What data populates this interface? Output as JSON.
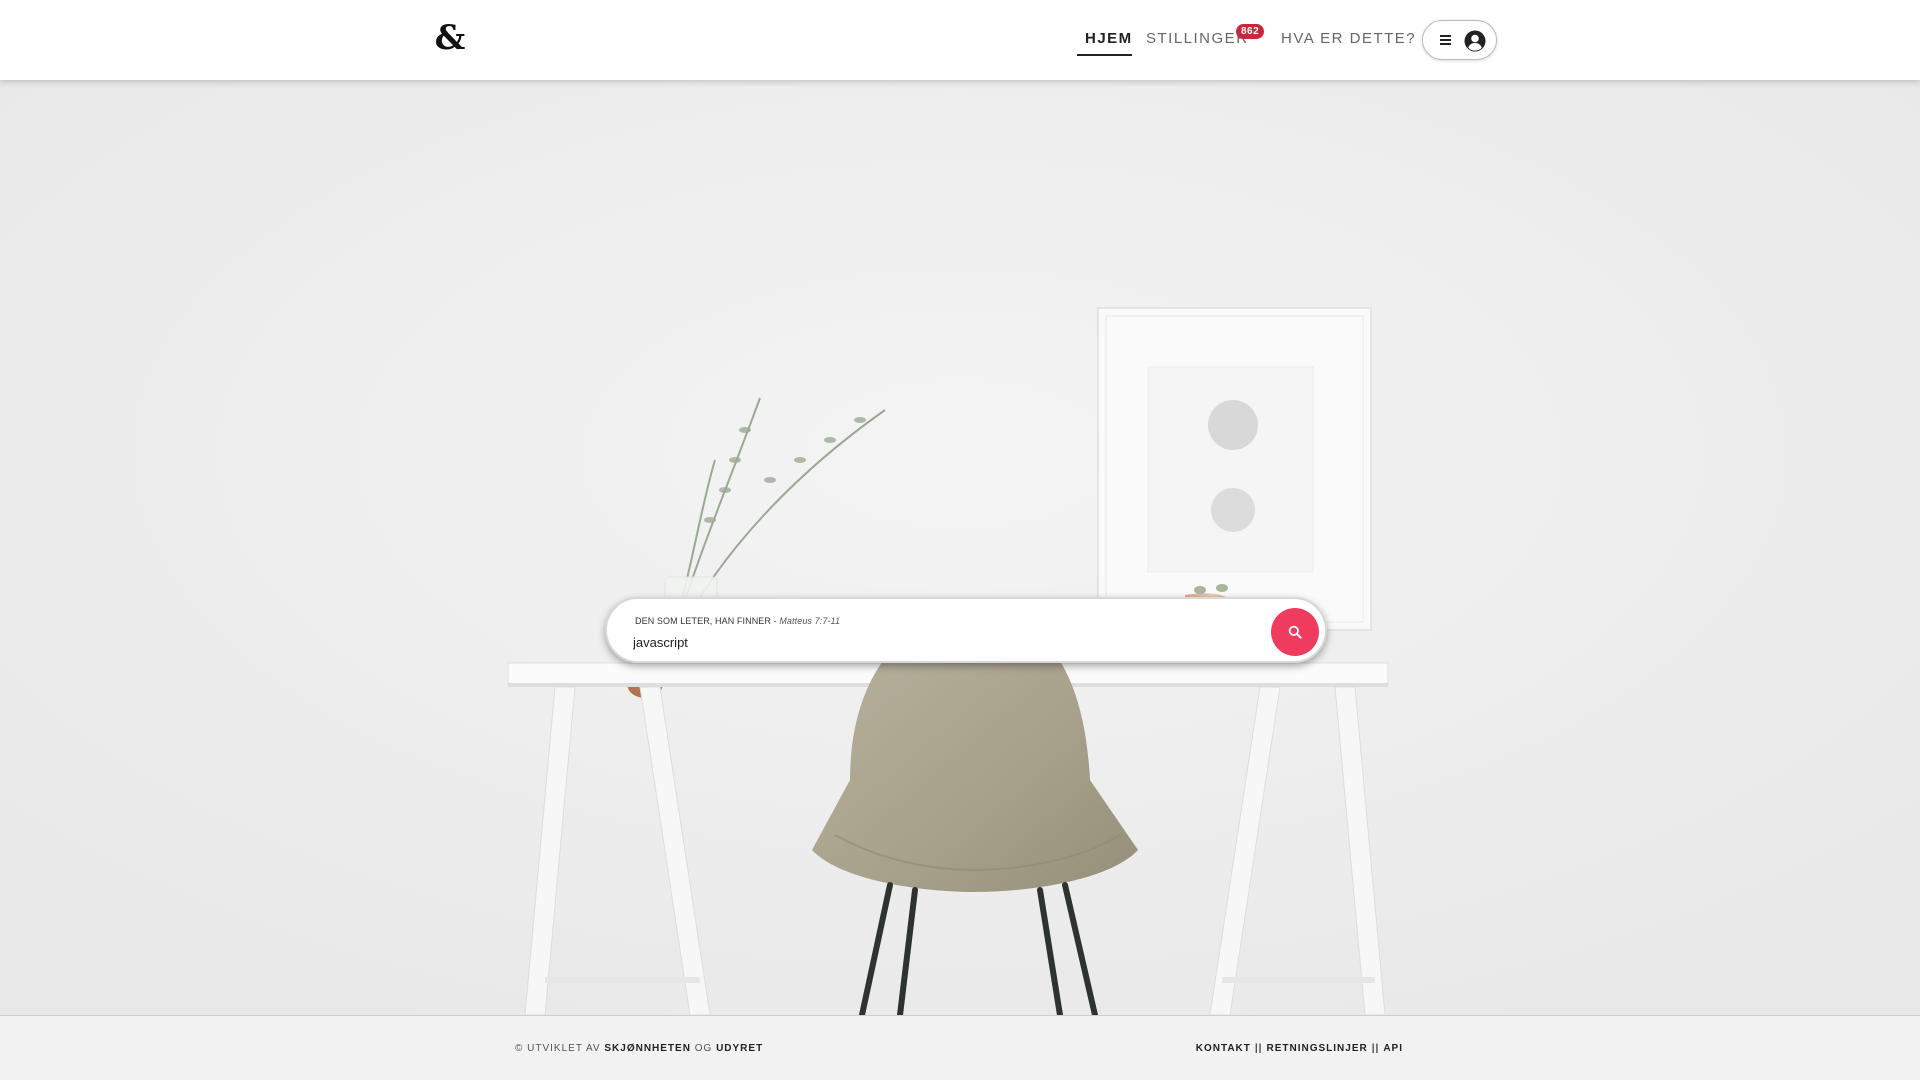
{
  "header": {
    "logo_text": "&",
    "nav": {
      "home": "HJEM",
      "jobs": "STILLINGER",
      "jobs_badge": "862",
      "about": "HVA ER DETTE?"
    },
    "user_menu": {
      "menu_icon": "hamburger-icon",
      "avatar_icon": "user-circle-icon"
    }
  },
  "search": {
    "label": "DEN SOM LETER, HAN FINNER - ",
    "label_citation": "Matteus 7:7-11",
    "value": "javascript",
    "button_icon": "search-icon"
  },
  "footer": {
    "left_prefix": "© UTVIKLET AV ",
    "left_name1": "SKJØNNHETEN",
    "left_middle": " OG ",
    "left_name2": "UDYRET",
    "links": {
      "contact": "KONTAKT",
      "separator": "||",
      "guidelines": "RETNINGSLINJER",
      "api": "API"
    }
  },
  "colors": {
    "accent": "#ef3b5d",
    "badge": "#c8283c",
    "header_bg": "#ffffff",
    "hero_bg": "#efefef"
  }
}
